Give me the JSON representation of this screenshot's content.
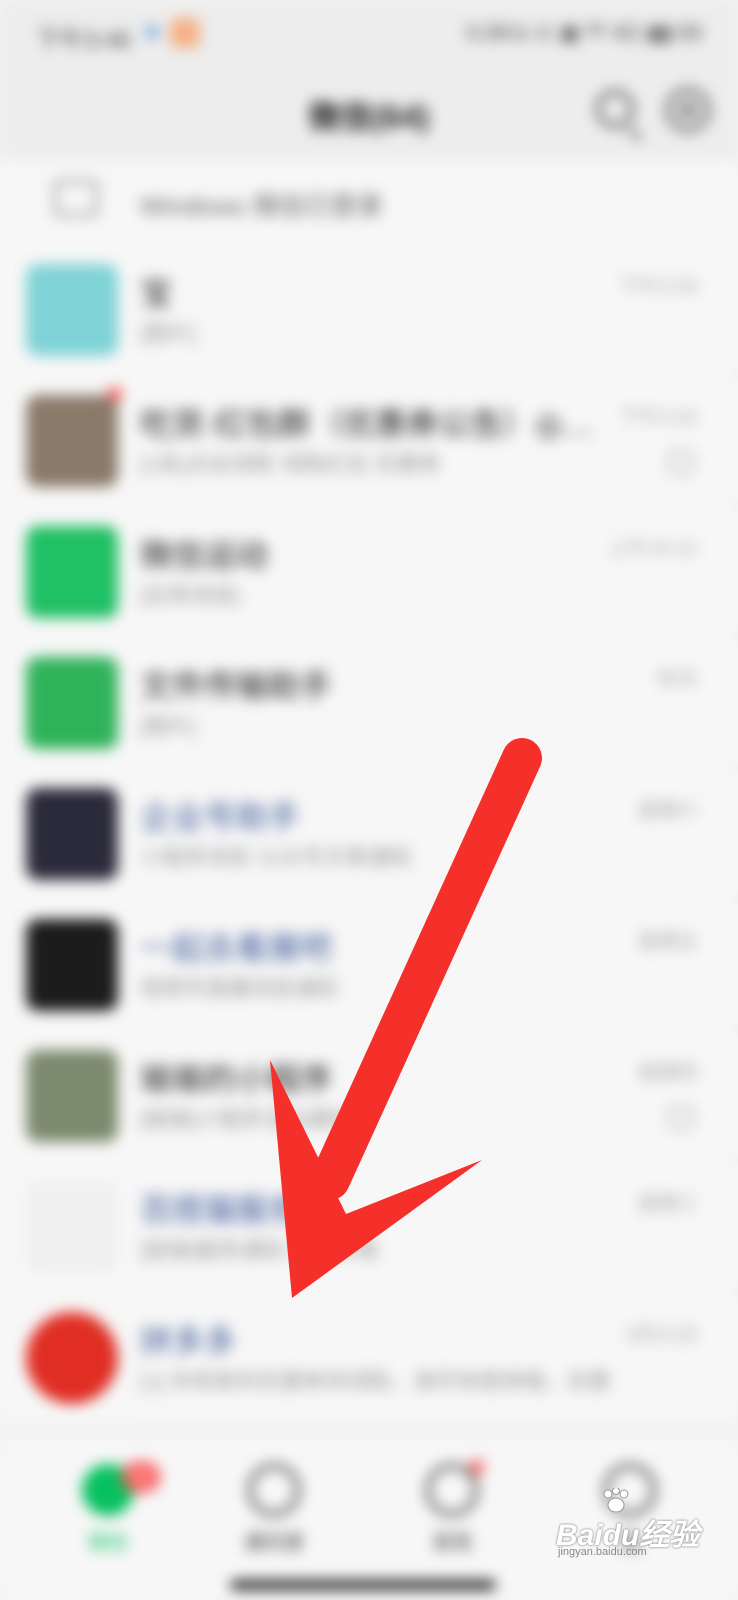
{
  "status_bar": {
    "time": "下午3:46",
    "right": "0.0K/s ⊙ ▣ ᴴᴰ 4G ▮▮ 69"
  },
  "header": {
    "title": "微信(64)"
  },
  "login_banner": {
    "text": "Windows 微信已登录"
  },
  "chats": [
    {
      "name": "宝",
      "preview": "[图片]",
      "time": "下午3:33",
      "avatar_color": "#7fd3d6",
      "link": false,
      "muted": false,
      "badge": false
    },
    {
      "name": "吃货·红包群（优惠券公告）◎…",
      "preview": "[1条]点击领取 领取红包 优惠券",
      "time": "下午3:32",
      "avatar_color": "#8a7a6a",
      "link": false,
      "muted": true,
      "badge": true
    },
    {
      "name": "微信运动",
      "preview": "[应用消息]",
      "time": "上午10:12",
      "avatar_color": "#20c064",
      "link": false,
      "muted": false,
      "badge": false
    },
    {
      "name": "文件传输助手",
      "preview": "[图片]",
      "time": "昨天",
      "avatar_color": "#2fb35a",
      "link": false,
      "muted": false,
      "badge": false
    },
    {
      "name": "企业号助手",
      "preview": "小程序消息·公众号文章通知",
      "time": "星期六",
      "avatar_color": "#2b2a3a",
      "link": true,
      "muted": false,
      "badge": false
    },
    {
      "name": "一起去看展吧",
      "preview": "视频号直播消息通知",
      "time": "星期五",
      "avatar_color": "#1c1c1c",
      "link": true,
      "muted": false,
      "badge": false
    },
    {
      "name": "瑜瑜的小程序",
      "preview": "[链接]小程序活动通知",
      "time": "星期四",
      "avatar_color": "#7c8a6e",
      "link": false,
      "muted": true,
      "badge": false
    },
    {
      "name": "百搭猫服务",
      "preview": "[链接]服务通知 查看详情",
      "time": "星期三",
      "avatar_color": "#f0f0f0",
      "link": true,
      "muted": false,
      "badge": false
    },
    {
      "name": "拼多多",
      "preview": "[1] 你有新的优惠券待领取，请尽快使用哦，优惠",
      "time": "3月21日",
      "avatar_color": "#e02e24",
      "link": true,
      "muted": false,
      "badge": false,
      "round": true
    }
  ],
  "tabs": [
    {
      "label": "微信",
      "badge": "64",
      "active": true
    },
    {
      "label": "通讯录",
      "badge": "",
      "active": false
    },
    {
      "label": "发现",
      "badge": "",
      "dot": true,
      "active": false
    },
    {
      "label": "我",
      "badge": "",
      "active": false
    }
  ],
  "watermark": {
    "brand": "Baidu经验",
    "sub": "jingyan.baidu.com"
  },
  "colors": {
    "arrow": "#f5302a",
    "accent": "#07c160",
    "badge": "#fa5151"
  }
}
